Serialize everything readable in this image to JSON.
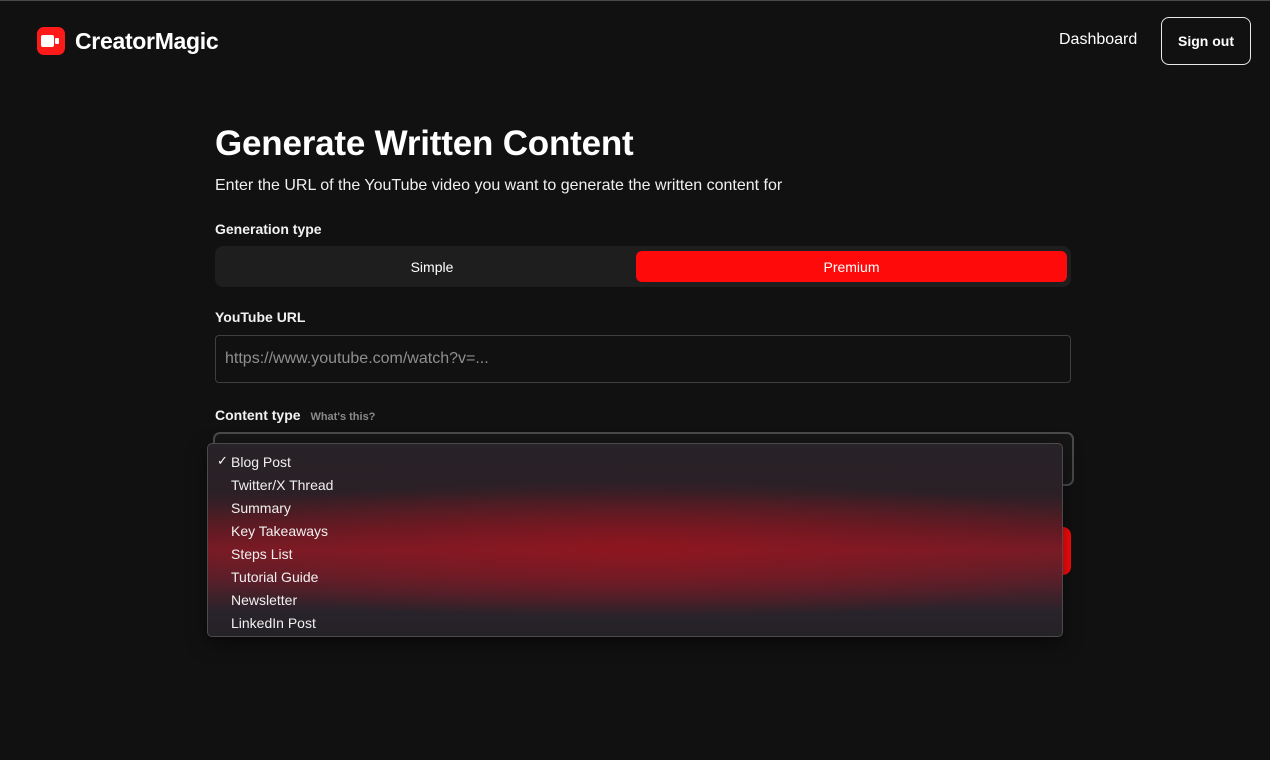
{
  "brand": {
    "name": "CreatorMagic",
    "accent": "#ff1a1a",
    "icon": "video-camera-icon"
  },
  "nav": {
    "dashboard_label": "Dashboard",
    "signout_label": "Sign out"
  },
  "main": {
    "title": "Generate Written Content",
    "subtitle": "Enter the URL of the YouTube video you want to generate the written content for"
  },
  "generation_type": {
    "label": "Generation type",
    "options": [
      "Simple",
      "Premium"
    ],
    "selected": "Premium"
  },
  "youtube_url": {
    "label": "YouTube URL",
    "value": "",
    "placeholder": "https://www.youtube.com/watch?v=..."
  },
  "content_type": {
    "label": "Content type",
    "help_link": "What's this?",
    "selected": "Blog Post",
    "check_mark": "✓",
    "options": [
      "Blog Post",
      "Twitter/X Thread",
      "Summary",
      "Key Takeaways",
      "Steps List",
      "Tutorial Guide",
      "Newsletter",
      "LinkedIn Post"
    ]
  }
}
